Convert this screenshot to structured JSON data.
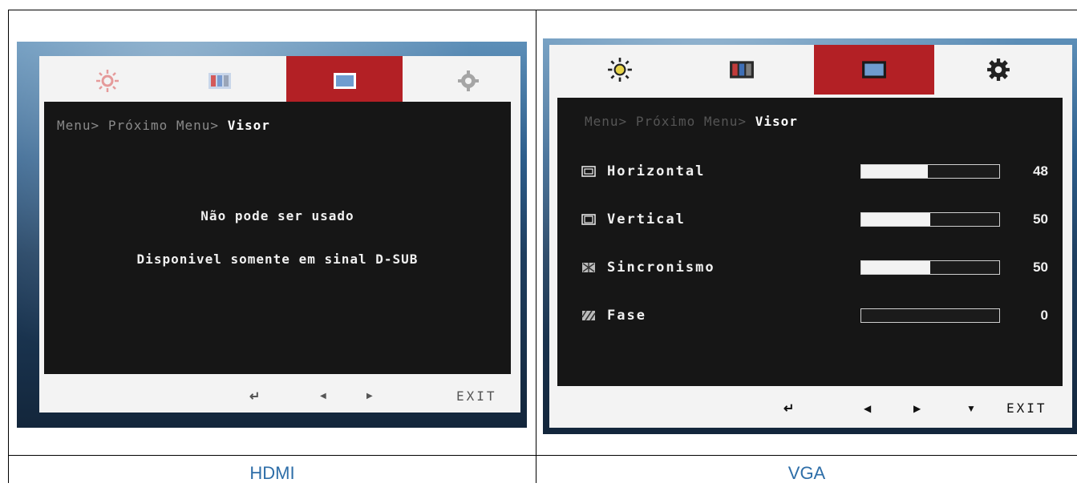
{
  "hdmi": {
    "breadcrumb": {
      "root": "Menu>",
      "next": "Próximo Menu>",
      "current": "Visor"
    },
    "message_line1": "Não pode ser usado",
    "message_line2": "Disponivel somente em sinal D-SUB",
    "footer": {
      "back": "↵",
      "left": "◀",
      "right": "▶",
      "exit": "EXIT"
    },
    "caption": "HDMI"
  },
  "vga": {
    "breadcrumb": {
      "root": "Menu>",
      "next": "Próximo Menu>",
      "current": "Visor"
    },
    "rows": [
      {
        "label": "Horizontal",
        "value": "48",
        "level": 0.48,
        "icon": "horizontal-position-icon"
      },
      {
        "label": "Vertical",
        "value": "50",
        "level": 0.5,
        "icon": "vertical-position-icon"
      },
      {
        "label": "Sincronismo",
        "value": "50",
        "level": 0.5,
        "icon": "clock-sync-icon"
      },
      {
        "label": "Fase",
        "value": "0",
        "level": 0.0,
        "icon": "phase-icon"
      }
    ],
    "footer": {
      "back": "↵",
      "left": "◀",
      "right": "▶",
      "down": "▼",
      "exit": "EXIT"
    },
    "caption": "VGA"
  },
  "tabs": [
    {
      "name": "brightness-icon",
      "active": false
    },
    {
      "name": "picture-icon",
      "active": false
    },
    {
      "name": "display-icon",
      "active": true
    },
    {
      "name": "settings-gear-icon",
      "active": false
    }
  ],
  "colors": {
    "active_tab": "#b32025",
    "panel": "#161616",
    "caption": "#2e6ea8"
  }
}
